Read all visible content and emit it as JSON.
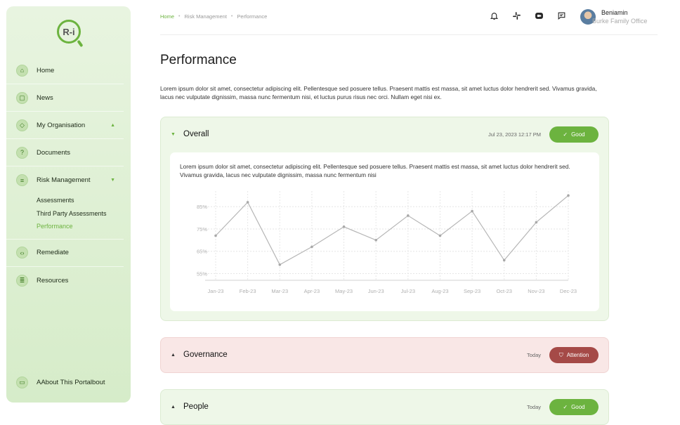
{
  "brand": {
    "logo_text": "R-i"
  },
  "sidebar": {
    "items": [
      {
        "label": "Home",
        "icon": "home-icon"
      },
      {
        "label": "News",
        "icon": "news-icon"
      },
      {
        "label": "My Organisation",
        "icon": "cube-icon",
        "caret": "▲"
      },
      {
        "label": "Documents",
        "icon": "document-icon"
      },
      {
        "label": "Risk Management",
        "icon": "clipboard-icon",
        "caret": "▼"
      },
      {
        "label": "Remediate",
        "icon": "remediate-icon"
      },
      {
        "label": "Resources",
        "icon": "resources-icon"
      }
    ],
    "subitems": [
      "Assessments",
      "Third Party Assessments",
      "Performance"
    ],
    "about": {
      "label": "AAbout This Portalbout",
      "icon": "monitor-icon"
    }
  },
  "breadcrumb": {
    "home": "Home",
    "section": "Risk Management",
    "current": "Performance",
    "separator": "•"
  },
  "user": {
    "name": "Beniamin",
    "org": "Burke Family Office"
  },
  "page": {
    "title": "Performance",
    "intro": "Lorem ipsum dolor sit amet, consectetur adipiscing elit. Pellentesque sed posuere tellus. Praesent mattis est massa, sit amet luctus dolor hendrerit sed. Vivamus gravida, lacus nec vulputate dignissim, massa nunc fermentum nisi, et luctus purus risus nec orci. Nullam eget nisi ex."
  },
  "cards": [
    {
      "title": "Overall",
      "caret": "▼",
      "date": "Jul 23, 2023 12:17 PM",
      "status": "Good",
      "status_icon": "check-icon",
      "body": "Lorem ipsum dolor sit amet, consectetur adipiscing elit. Pellentesque sed posuere tellus. Praesent mattis est massa, sit amet luctus dolor hendrerit sed. Vivamus gravida, lacus nec vulputate dignissim, massa nunc fermentum nisi"
    },
    {
      "title": "Governance",
      "caret": "▲",
      "date": "Today",
      "status": "Attention",
      "status_icon": "shield-icon"
    },
    {
      "title": "People",
      "caret": "▲",
      "date": "Today",
      "status": "Good",
      "status_icon": "check-icon"
    }
  ],
  "colors": {
    "accent": "#6cb33f",
    "attention": "#a54a47",
    "line": "#b5b5b5"
  },
  "chart_data": {
    "type": "line",
    "categories": [
      "Jan-23",
      "Feb-23",
      "Mar-23",
      "Apr-23",
      "May-23",
      "Jun-23",
      "Jul-23",
      "Aug-23",
      "Sep-23",
      "Oct-23",
      "Nov-23",
      "Dec-23"
    ],
    "values": [
      72,
      87,
      59,
      67,
      76,
      70,
      81,
      72,
      83,
      61,
      78,
      90
    ],
    "yticks": [
      "85%",
      "75%",
      "65%",
      "55%"
    ],
    "ytick_values": [
      85,
      75,
      65,
      55
    ],
    "ylim": [
      52,
      92
    ],
    "grid": true
  }
}
